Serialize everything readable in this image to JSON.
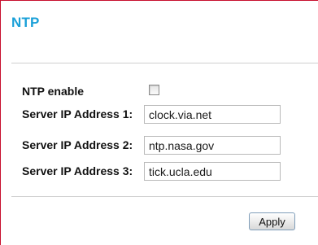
{
  "page": {
    "title": "NTP",
    "accent_color": "#1aa0d8",
    "border_color": "#c8102e"
  },
  "form": {
    "ntp_enable": {
      "label": "NTP enable",
      "checked": false
    },
    "servers": [
      {
        "label": "Server IP Address 1:",
        "value": "clock.via.net"
      },
      {
        "label": "Server IP Address 2:",
        "value": "ntp.nasa.gov"
      },
      {
        "label": "Server IP Address 3:",
        "value": "tick.ucla.edu"
      }
    ]
  },
  "actions": {
    "apply_label": "Apply"
  }
}
